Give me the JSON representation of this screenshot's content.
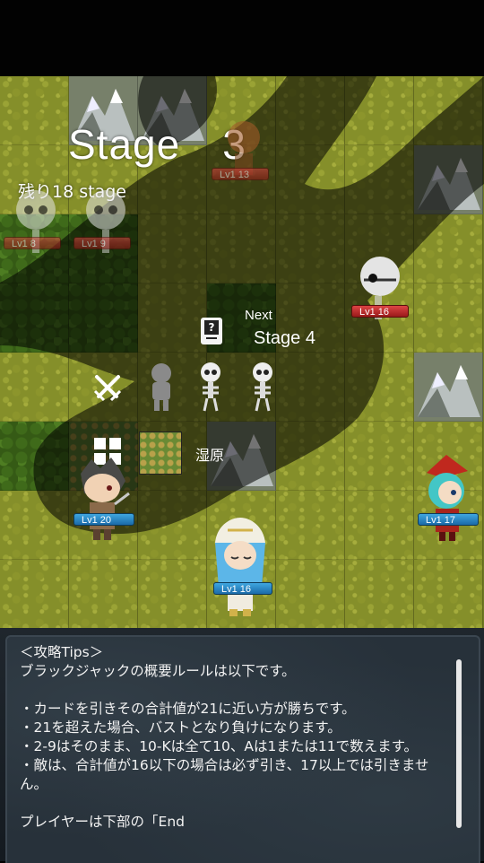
{
  "stage": {
    "title": "Stage　3",
    "remaining": "残り18 stage"
  },
  "next": {
    "label": "Next",
    "stage": "Stage 4",
    "icon": "mystery-card-icon"
  },
  "enemies_preview": {
    "icon": "crossed-swords-icon",
    "units": [
      "knight-silhouette",
      "skeleton",
      "skeleton"
    ]
  },
  "terrain": {
    "icon": "grid-terrain-icon",
    "name": "湿原"
  },
  "units": {
    "enemy_top": {
      "hp": "Lv1  13"
    },
    "skeleton_a": {
      "hp": "Lv1    8"
    },
    "skeleton_b": {
      "hp": "Lv1    9"
    },
    "skull_right": {
      "hp": "Lv1  16"
    },
    "warrior": {
      "hp": "Lv1  20"
    },
    "mage_right": {
      "hp": "Lv1  17"
    },
    "priestess": {
      "hp": "Lv1  16"
    }
  },
  "tips": {
    "lines": [
      "＜攻略Tips＞",
      "ブラックジャックの概要ルールは以下です。",
      "",
      "・カードを引きその合計値が21に近い方が勝ちです。",
      "・21を超えた場合、バストとなり負けになります。",
      "・2-9はそのまま、10-Kは全て10、Aは1または11で数えます。",
      "・敵は、合計値が16以下の場合は必ず引き、17以上では引きません。",
      "",
      "プレイヤーは下部の「End"
    ]
  },
  "colors": {
    "enemy_hp": "#b52525",
    "ally_hp": "#2a85c4",
    "grass": "#858f2a",
    "panel": "#27313a"
  }
}
